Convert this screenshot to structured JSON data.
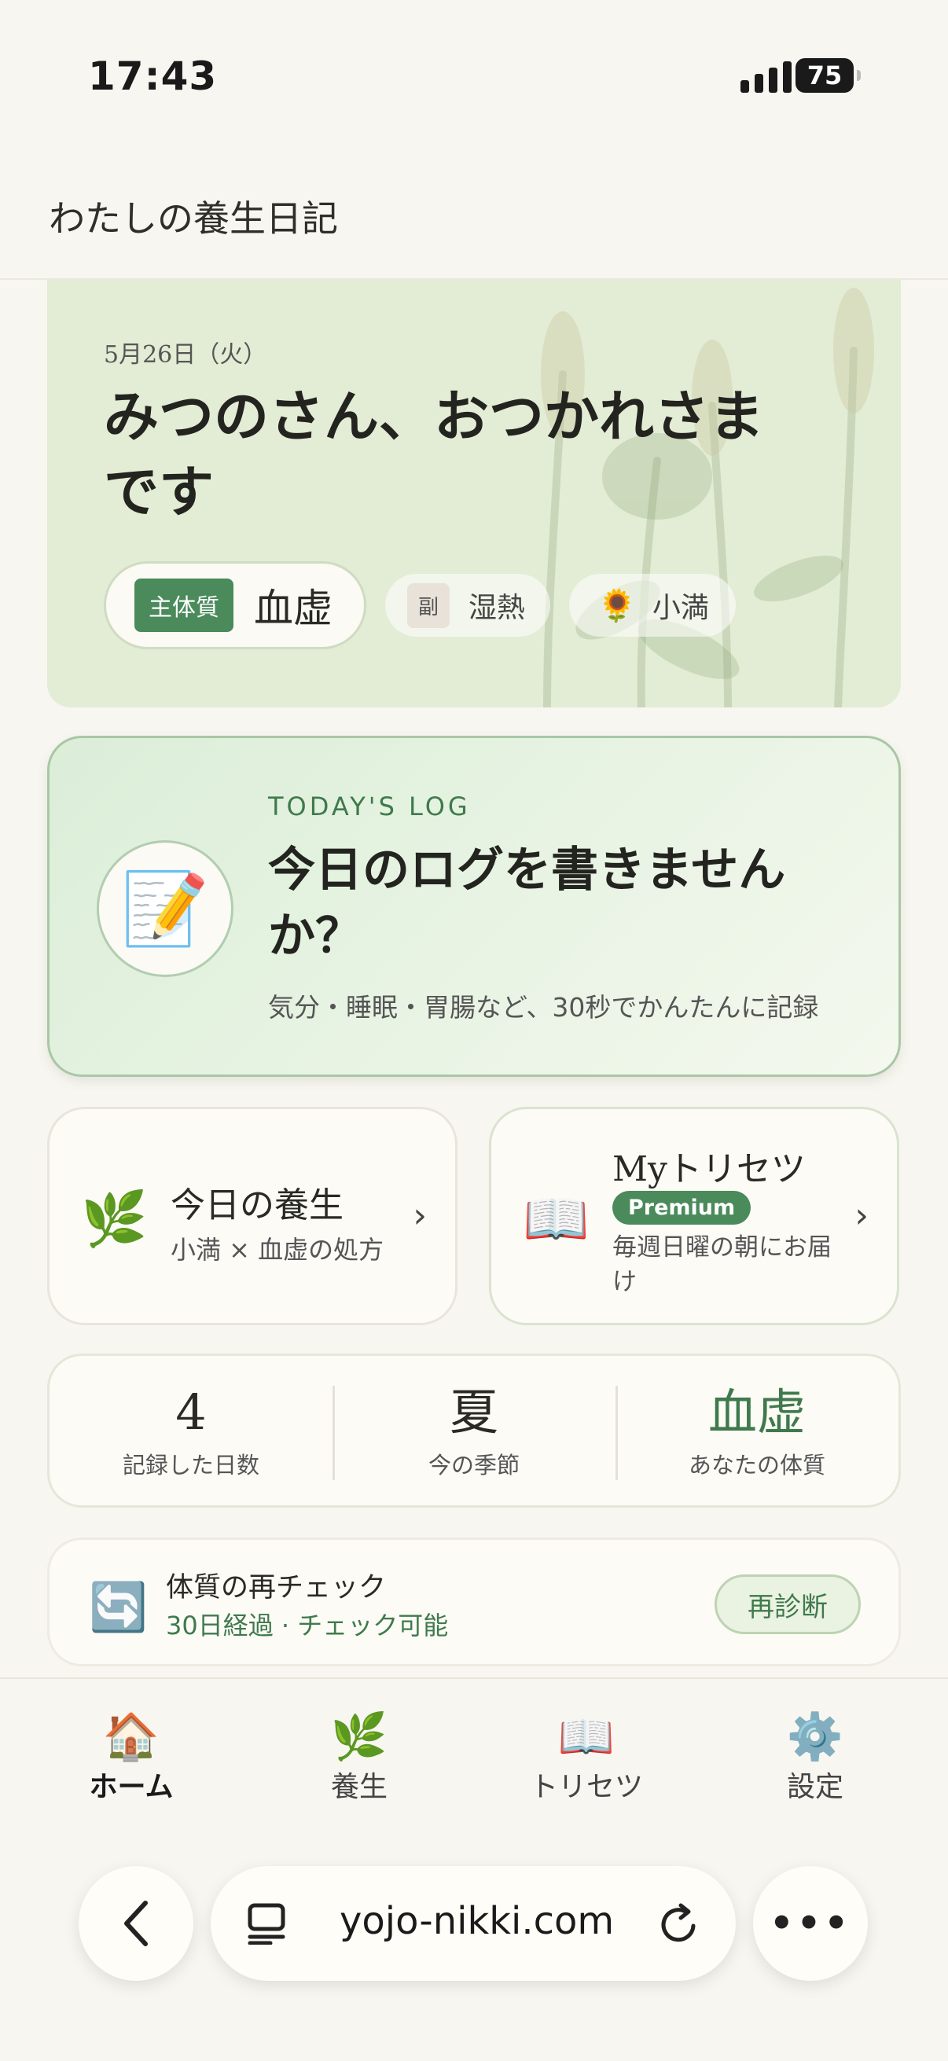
{
  "status": {
    "time": "17:43",
    "battery": "75"
  },
  "header": {
    "title": "わたしの養生日記"
  },
  "hero": {
    "date": "5月26日（火）",
    "greeting": "みつのさん、おつかれさまです",
    "main_type_tag": "主体質",
    "main_type": "血虚",
    "sub_type_tag": "副",
    "sub_type": "湿熱",
    "season_icon": "sunflower-icon",
    "season": "小満"
  },
  "log": {
    "icon": "memo-icon",
    "eyebrow": "TODAY'S LOG",
    "title": "今日のログを書きませんか？",
    "subtitle": "気分・睡眠・胃腸など、30秒でかんたんに記録"
  },
  "cards": {
    "yojo": {
      "icon": "herb-icon",
      "title": "今日の養生",
      "subtitle": "小満 × 血虚の処方"
    },
    "torisetsu": {
      "icon": "book-icon",
      "title": "Myトリセツ",
      "badge": "Premium",
      "subtitle": "毎週日曜の朝にお届け"
    }
  },
  "stats": [
    {
      "value": "4",
      "label": "記録した日数"
    },
    {
      "value": "夏",
      "label": "今の季節"
    },
    {
      "value": "血虚",
      "label": "あなたの体質"
    }
  ],
  "recheck": {
    "icon": "refresh-icon",
    "title": "体質の再チェック",
    "subtitle": "30日経過 · チェック可能",
    "button": "再診断"
  },
  "tabbar": [
    {
      "icon": "house-icon",
      "label": "ホーム",
      "active": true
    },
    {
      "icon": "herb-icon",
      "label": "養生",
      "active": false
    },
    {
      "icon": "book-icon",
      "label": "トリセツ",
      "active": false
    },
    {
      "icon": "gear-icon",
      "label": "設定",
      "active": false
    }
  ],
  "browser": {
    "url": "yojo-nikki.com"
  },
  "colors": {
    "accent": "#4a8a5b",
    "background": "#f8f6f0",
    "hero": "#e3ecd4"
  }
}
